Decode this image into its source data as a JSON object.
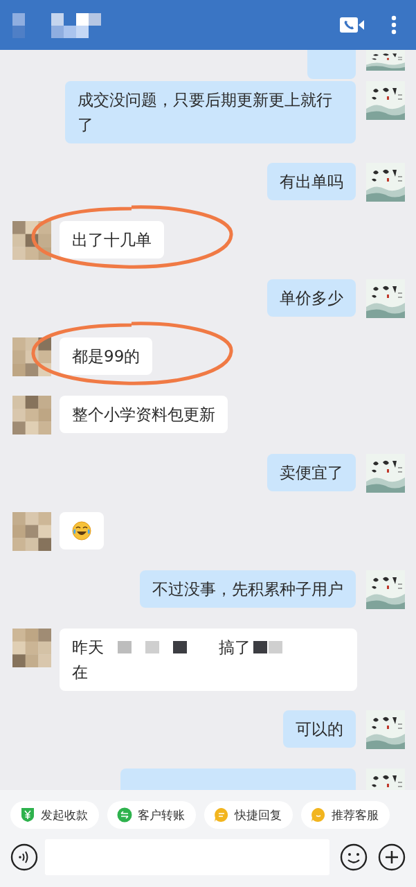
{
  "messages": [
    {
      "outgoing": true,
      "kind": "cut",
      "highlighted": false
    },
    {
      "outgoing": true,
      "kind": "text",
      "text": "成交没问题，只要后期更新更上就行了",
      "highlighted": false
    },
    {
      "outgoing": true,
      "kind": "text",
      "text": "有出单吗",
      "highlighted": false
    },
    {
      "outgoing": false,
      "kind": "text",
      "text": "出了十几单",
      "highlighted": true
    },
    {
      "outgoing": true,
      "kind": "text",
      "text": "单价多少",
      "highlighted": false
    },
    {
      "outgoing": false,
      "kind": "text",
      "text": "都是99的",
      "highlighted": true
    },
    {
      "outgoing": false,
      "kind": "text",
      "text": "整个小学资料包更新",
      "highlighted": false
    },
    {
      "outgoing": true,
      "kind": "text",
      "text": "卖便宜了",
      "highlighted": false
    },
    {
      "outgoing": false,
      "kind": "emoji",
      "highlighted": false
    },
    {
      "outgoing": true,
      "kind": "text",
      "text": "不过没事，先积累种子用户",
      "highlighted": false
    },
    {
      "outgoing": false,
      "kind": "redacted",
      "lines": [
        [
          "昨天",
          "搞了"
        ],
        [
          "在"
        ]
      ],
      "highlighted": false
    },
    {
      "outgoing": true,
      "kind": "text",
      "text": "可以的",
      "highlighted": false
    },
    {
      "outgoing": true,
      "kind": "cut",
      "highlighted": false
    }
  ],
  "quick_actions": [
    {
      "label": "发起收款",
      "kind": "payment",
      "color": "#2eb24d"
    },
    {
      "label": "客户转账",
      "kind": "transfer",
      "color": "#2eb24d"
    },
    {
      "label": "快捷回复",
      "kind": "reply",
      "color": "#f2b51f"
    },
    {
      "label": "推荐客服",
      "kind": "service",
      "color": "#f2b51f"
    }
  ]
}
